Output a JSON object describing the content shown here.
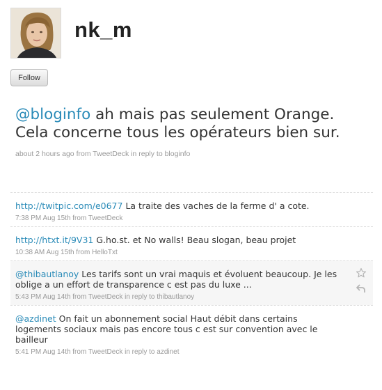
{
  "profile": {
    "screen_name": "nk_m",
    "follow_label": "Follow"
  },
  "main_tweet": {
    "mention": "@bloginfo",
    "text": " ah mais pas seulement Orange. Cela concerne tous les opérateurs bien sur.",
    "meta": "about 2 hours ago from TweetDeck in reply to bloginfo"
  },
  "tweets": [
    {
      "link": "http://twitpic.com/e0677",
      "text": " La traite des vaches de la ferme d' a cote.",
      "meta": "7:38 PM Aug 15th from TweetDeck"
    },
    {
      "link": "http://htxt.it/9V31",
      "text": " G.ho.st. et No walls! Beau slogan, beau projet",
      "meta": "10:38 AM Aug 15th from HelloTxt"
    },
    {
      "link": "@thibautlanoy",
      "text": " Les tarifs sont un vrai maquis et évoluent beaucoup. Je les oblige a un effort de transparence c est pas du luxe ...",
      "meta": "5:43 PM Aug 14th from TweetDeck in reply to thibautlanoy"
    },
    {
      "link": "@azdinet",
      "text": " On fait un abonnement social Haut débit dans certains logements sociaux mais pas encore tous c est sur convention avec le bailleur",
      "meta": "5:41 PM Aug 14th from TweetDeck in reply to azdinet"
    }
  ],
  "icons": {
    "favorite": "star-icon",
    "reply": "reply-arrow-icon"
  },
  "colors": {
    "link": "#2a8bb8",
    "meta": "#999999",
    "text": "#333333"
  }
}
